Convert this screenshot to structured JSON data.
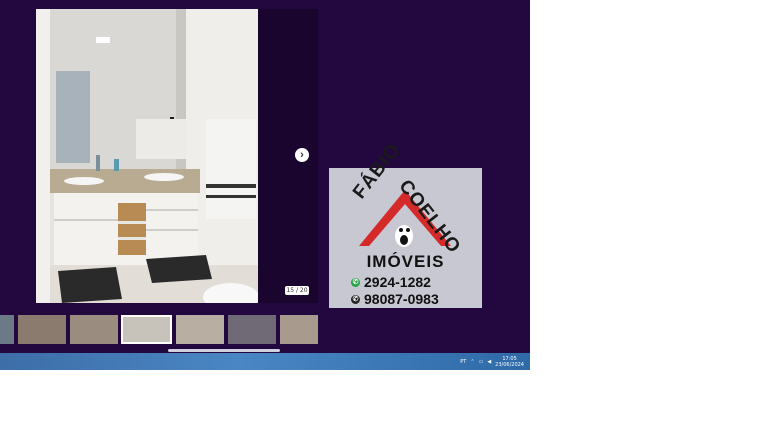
{
  "viewer": {
    "counter": "15 / 20",
    "next_glyph": "›"
  },
  "logo": {
    "name_left": "FÁBIO",
    "name_right": "COELHO",
    "tagline": "IMÓVEIS",
    "phone_1": "2924-1282",
    "phone_2": "98087-0983",
    "roof_color": "#d42a2a"
  },
  "taskbar": {
    "language": "PT",
    "time": "17:05",
    "date": "23/06/2024"
  }
}
